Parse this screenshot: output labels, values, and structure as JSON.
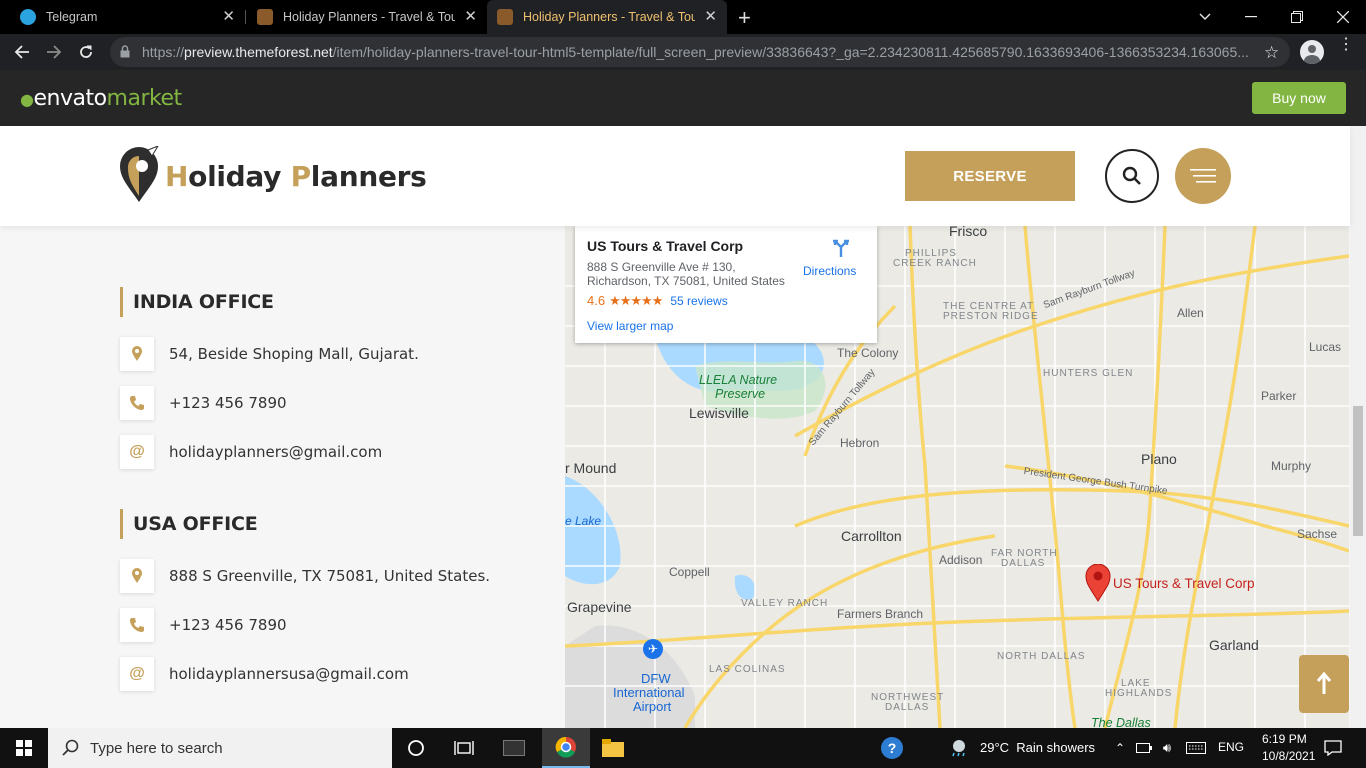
{
  "browser": {
    "tabs": [
      {
        "title": "Telegram",
        "active": false
      },
      {
        "title": "Holiday Planners - Travel & Tour",
        "active": false
      },
      {
        "title": "Holiday Planners - Travel & Tour",
        "active": true
      }
    ],
    "url_prefix": "https://",
    "url_host": "preview.themeforest.net",
    "url_path": "/item/holiday-planners-travel-tour-html5-template/full_screen_preview/33836643?_ga=2.234230811.425685790.1633693406-1366353234.163065..."
  },
  "envato": {
    "logo_main": "envato",
    "logo_accent": "market",
    "buy_label": "Buy now",
    "accent_color": "#82b541"
  },
  "site": {
    "logo_first_letter": "H",
    "logo_first_rest": "oliday ",
    "logo_second_letter": "P",
    "logo_second_rest": "lanners",
    "reserve_label": "RESERVE",
    "brand_color": "#c5a05a"
  },
  "offices": [
    {
      "heading": "INDIA OFFICE",
      "address": "54, Beside Shoping Mall, Gujarat.",
      "phone": "+123 456 7890",
      "email": "holidayplanners@gmail.com"
    },
    {
      "heading": "USA OFFICE",
      "address": "888 S Greenville, TX 75081, United States.",
      "phone": "+123 456 7890",
      "email": "holidayplannersusa@gmail.com"
    }
  ],
  "icons": {
    "location": "location-pin-icon",
    "phone": "phone-icon",
    "email": "at-sign-icon",
    "email_glyph": "@"
  },
  "map": {
    "card_name": "US Tours & Travel Corp",
    "card_address_1": "888 S Greenville Ave # 130,",
    "card_address_2": "Richardson, TX 75081, United States",
    "card_rating": "4.6",
    "card_stars": "★★★★★",
    "card_reviews": "55 reviews",
    "card_larger": "View larger map",
    "card_directions": "Directions",
    "pin_label": "US Tours & Travel Corp",
    "places": {
      "frisco": "Frisco",
      "allen": "Allen",
      "lucas": "Lucas",
      "parker": "Parker",
      "plano": "Plano",
      "murphy": "Murphy",
      "sachse": "Sachse",
      "garland": "Garland",
      "the_colony": "The Colony",
      "lewisville": "Lewisville",
      "hebron": "Hebron",
      "carrollton": "Carrollton",
      "addison": "Addison",
      "coppell": "Coppell",
      "grapevine": "Grapevine",
      "farmers_branch": "Farmers Branch",
      "flower_mound": "r Mound",
      "lake": "e Lake",
      "dfw": "DFW",
      "international": "International",
      "airport": "Airport",
      "llela": "LLELA Nature",
      "preserve": "Preserve",
      "the_dallas": "The Dallas",
      "phillips": "PHILLIPS",
      "creek_ranch": "CREEK RANCH",
      "centre": "THE CENTRE AT",
      "preston_ridge": "PRESTON RIDGE",
      "hunters_glen": "HUNTERS GLEN",
      "far_north": "FAR NORTH",
      "dallas": "DALLAS",
      "valley_ranch": "VALLEY RANCH",
      "las_colinas": "LAS COLINAS",
      "north_dallas": "NORTH DALLAS",
      "northwest": "NORTHWEST",
      "nw_dallas": "DALLAS",
      "lake_highlands": "LAKE",
      "highlands": "HIGHLANDS",
      "sam_rayburn": "Sam Rayburn Tollway",
      "sam_rayburn2": "Sam Rayburn Tollway",
      "pgbt": "President George Bush Turnpike"
    }
  },
  "taskbar": {
    "search_placeholder": "Type here to search",
    "weather": "29°C  Rain showers",
    "language": "ENG",
    "time": "6:19 PM",
    "date": "10/8/2021"
  }
}
